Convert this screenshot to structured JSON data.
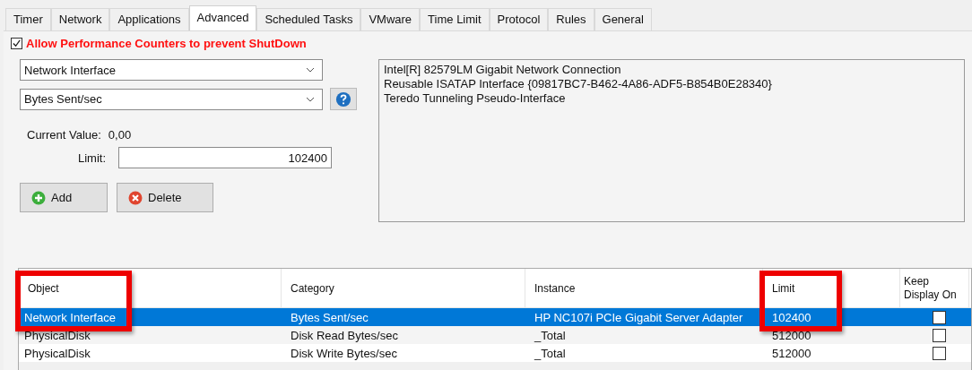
{
  "tabs": [
    {
      "label": "Timer",
      "selected": false
    },
    {
      "label": "Network",
      "selected": false
    },
    {
      "label": "Applications",
      "selected": false
    },
    {
      "label": "Advanced",
      "selected": true
    },
    {
      "label": "Scheduled Tasks",
      "selected": false
    },
    {
      "label": "VMware",
      "selected": false
    },
    {
      "label": "Time Limit",
      "selected": false
    },
    {
      "label": "Protocol",
      "selected": false
    },
    {
      "label": "Rules",
      "selected": false
    },
    {
      "label": "General",
      "selected": false
    }
  ],
  "allow_counters": {
    "label": "Allow Performance Counters to prevent ShutDown",
    "checked": true
  },
  "object_dropdown": {
    "value": "Network Interface"
  },
  "counter_dropdown": {
    "value": "Bytes Sent/sec"
  },
  "current_value": {
    "label": "Current Value:",
    "value": "0,00"
  },
  "limit": {
    "label": "Limit:",
    "value": "102400"
  },
  "buttons": [
    {
      "label": "Add",
      "kind": "add"
    },
    {
      "label": "Delete",
      "kind": "delete"
    }
  ],
  "instances": [
    "Intel[R] 82579LM Gigabit Network Connection",
    "Reusable ISATAP Interface {09817BC7-B462-4A86-ADF5-B854B0E28340}",
    "Teredo Tunneling Pseudo-Interface"
  ],
  "table": {
    "columns": [
      {
        "label": "Object",
        "highlighted": true
      },
      {
        "label": "Category",
        "highlighted": false
      },
      {
        "label": "Instance",
        "highlighted": false
      },
      {
        "label": "Limit",
        "highlighted": true
      },
      {
        "label": "Keep Display On",
        "highlighted": false
      }
    ],
    "rows": [
      {
        "object": "Network Interface",
        "category": "Bytes Sent/sec",
        "instance": "HP NC107i PCIe Gigabit Server Adapter",
        "limit": "102400",
        "keep_display_on": false,
        "selected": true
      },
      {
        "object": "PhysicalDisk",
        "category": "Disk Read Bytes/sec",
        "instance": "_Total",
        "limit": "512000",
        "keep_display_on": false,
        "selected": false
      },
      {
        "object": "PhysicalDisk",
        "category": "Disk Write Bytes/sec",
        "instance": "_Total",
        "limit": "512000",
        "keep_display_on": false,
        "selected": false
      }
    ]
  }
}
